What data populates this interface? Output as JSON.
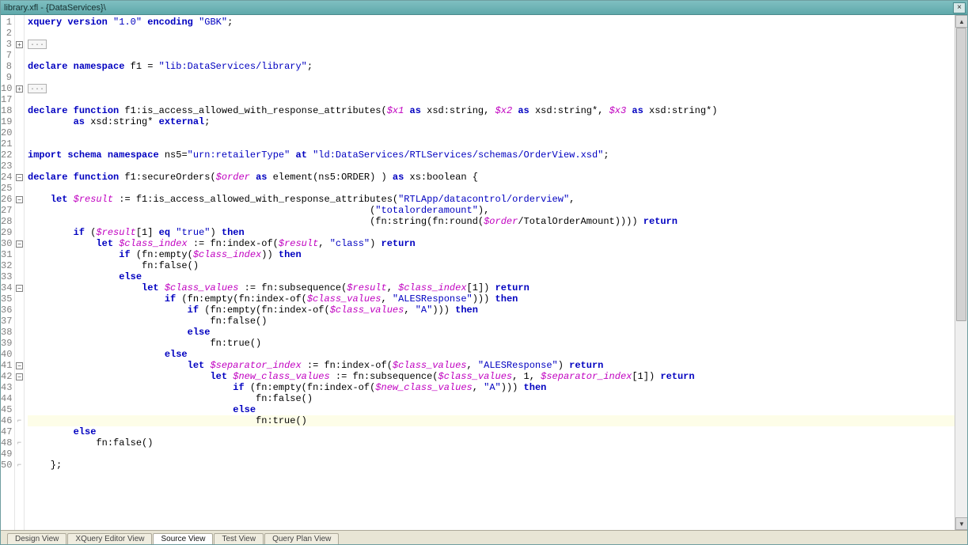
{
  "title": "library.xfl - {DataServices}\\",
  "close_label": "×",
  "fold_stub": "...",
  "scrollbar": {
    "up": "▲",
    "down": "▼"
  },
  "tabs": [
    {
      "label": "Design View"
    },
    {
      "label": "XQuery Editor View"
    },
    {
      "label": "Source View",
      "active": true
    },
    {
      "label": "Test View"
    },
    {
      "label": "Query Plan View"
    }
  ],
  "cursor_line_index": 36,
  "lines": [
    {
      "num": 1,
      "tokens": [
        [
          "kw",
          "xquery"
        ],
        [
          "norm",
          " "
        ],
        [
          "kw",
          "version"
        ],
        [
          "norm",
          " "
        ],
        [
          "str",
          "\"1.0\""
        ],
        [
          "norm",
          " "
        ],
        [
          "kw",
          "encoding"
        ],
        [
          "norm",
          " "
        ],
        [
          "str",
          "\"GBK\""
        ],
        [
          "norm",
          ";"
        ]
      ]
    },
    {
      "num": 2,
      "tokens": []
    },
    {
      "num": 3,
      "fold": "plus",
      "stub": true,
      "tokens": []
    },
    {
      "num": 7,
      "tokens": []
    },
    {
      "num": 8,
      "tokens": [
        [
          "kw",
          "declare"
        ],
        [
          "norm",
          " "
        ],
        [
          "kw",
          "namespace"
        ],
        [
          "norm",
          " f1 = "
        ],
        [
          "str",
          "\"lib:DataServices/library\""
        ],
        [
          "norm",
          ";"
        ]
      ]
    },
    {
      "num": 9,
      "tokens": []
    },
    {
      "num": 10,
      "fold": "plus",
      "stub": true,
      "tokens": []
    },
    {
      "num": 17,
      "tokens": []
    },
    {
      "num": 18,
      "tokens": [
        [
          "kw",
          "declare"
        ],
        [
          "norm",
          " "
        ],
        [
          "kw",
          "function"
        ],
        [
          "norm",
          " f1:is_access_allowed_with_response_attributes("
        ],
        [
          "var",
          "$x1"
        ],
        [
          "norm",
          " "
        ],
        [
          "kw",
          "as"
        ],
        [
          "norm",
          " xsd:string, "
        ],
        [
          "var",
          "$x2"
        ],
        [
          "norm",
          " "
        ],
        [
          "kw",
          "as"
        ],
        [
          "norm",
          " xsd:string*, "
        ],
        [
          "var",
          "$x3"
        ],
        [
          "norm",
          " "
        ],
        [
          "kw",
          "as"
        ],
        [
          "norm",
          " xsd:string*)"
        ]
      ]
    },
    {
      "num": 19,
      "tokens": [
        [
          "norm",
          "        "
        ],
        [
          "kw",
          "as"
        ],
        [
          "norm",
          " xsd:string* "
        ],
        [
          "kw",
          "external"
        ],
        [
          "norm",
          ";"
        ]
      ]
    },
    {
      "num": 20,
      "tokens": []
    },
    {
      "num": 21,
      "tokens": []
    },
    {
      "num": 22,
      "tokens": [
        [
          "kw",
          "import"
        ],
        [
          "norm",
          " "
        ],
        [
          "kw",
          "schema"
        ],
        [
          "norm",
          " "
        ],
        [
          "kw",
          "namespace"
        ],
        [
          "norm",
          " ns5="
        ],
        [
          "str",
          "\"urn:retailerType\""
        ],
        [
          "norm",
          " "
        ],
        [
          "kw",
          "at"
        ],
        [
          "norm",
          " "
        ],
        [
          "str",
          "\"ld:DataServices/RTLServices/schemas/OrderView.xsd\""
        ],
        [
          "norm",
          ";"
        ]
      ]
    },
    {
      "num": 23,
      "tokens": []
    },
    {
      "num": 24,
      "fold": "minus",
      "tokens": [
        [
          "kw",
          "declare"
        ],
        [
          "norm",
          " "
        ],
        [
          "kw",
          "function"
        ],
        [
          "norm",
          " f1:secureOrders("
        ],
        [
          "var",
          "$order"
        ],
        [
          "norm",
          " "
        ],
        [
          "kw",
          "as"
        ],
        [
          "norm",
          " element(ns5:ORDER) ) "
        ],
        [
          "kw",
          "as"
        ],
        [
          "norm",
          " xs:boolean {"
        ]
      ]
    },
    {
      "num": 25,
      "tokens": []
    },
    {
      "num": 26,
      "fold": "minus",
      "tokens": [
        [
          "norm",
          "    "
        ],
        [
          "kw",
          "let"
        ],
        [
          "norm",
          " "
        ],
        [
          "var",
          "$result"
        ],
        [
          "norm",
          " := f1:is_access_allowed_with_response_attributes("
        ],
        [
          "str",
          "\"RTLApp/datacontrol/orderview\""
        ],
        [
          "norm",
          ","
        ]
      ]
    },
    {
      "num": 27,
      "tokens": [
        [
          "norm",
          "                                                            ("
        ],
        [
          "str",
          "\"totalorderamount\""
        ],
        [
          "norm",
          "),"
        ]
      ]
    },
    {
      "num": 28,
      "tokens": [
        [
          "norm",
          "                                                            (fn:string(fn:round("
        ],
        [
          "var",
          "$order"
        ],
        [
          "norm",
          "/TotalOrderAmount)))) "
        ],
        [
          "kw",
          "return"
        ]
      ]
    },
    {
      "num": 29,
      "tokens": [
        [
          "norm",
          "        "
        ],
        [
          "kw",
          "if"
        ],
        [
          "norm",
          " ("
        ],
        [
          "var",
          "$result"
        ],
        [
          "norm",
          "[1] "
        ],
        [
          "kw",
          "eq"
        ],
        [
          "norm",
          " "
        ],
        [
          "str",
          "\"true\""
        ],
        [
          "norm",
          ") "
        ],
        [
          "kw",
          "then"
        ]
      ]
    },
    {
      "num": 30,
      "fold": "minus",
      "tokens": [
        [
          "norm",
          "            "
        ],
        [
          "kw",
          "let"
        ],
        [
          "norm",
          " "
        ],
        [
          "var",
          "$class_index"
        ],
        [
          "norm",
          " := fn:index-of("
        ],
        [
          "var",
          "$result"
        ],
        [
          "norm",
          ", "
        ],
        [
          "str",
          "\"class\""
        ],
        [
          "norm",
          ") "
        ],
        [
          "kw",
          "return"
        ]
      ]
    },
    {
      "num": 31,
      "tokens": [
        [
          "norm",
          "                "
        ],
        [
          "kw",
          "if"
        ],
        [
          "norm",
          " (fn:empty("
        ],
        [
          "var",
          "$class_index"
        ],
        [
          "norm",
          ")) "
        ],
        [
          "kw",
          "then"
        ]
      ]
    },
    {
      "num": 32,
      "tokens": [
        [
          "norm",
          "                    fn:false()"
        ]
      ]
    },
    {
      "num": 33,
      "tokens": [
        [
          "norm",
          "                "
        ],
        [
          "kw",
          "else"
        ]
      ]
    },
    {
      "num": 34,
      "fold": "minus",
      "tokens": [
        [
          "norm",
          "                    "
        ],
        [
          "kw",
          "let"
        ],
        [
          "norm",
          " "
        ],
        [
          "var",
          "$class_values"
        ],
        [
          "norm",
          " := fn:subsequence("
        ],
        [
          "var",
          "$result"
        ],
        [
          "norm",
          ", "
        ],
        [
          "var",
          "$class_index"
        ],
        [
          "norm",
          "[1]) "
        ],
        [
          "kw",
          "return"
        ]
      ]
    },
    {
      "num": 35,
      "tokens": [
        [
          "norm",
          "                        "
        ],
        [
          "kw",
          "if"
        ],
        [
          "norm",
          " (fn:empty(fn:index-of("
        ],
        [
          "var",
          "$class_values"
        ],
        [
          "norm",
          ", "
        ],
        [
          "str",
          "\"ALESResponse\""
        ],
        [
          "norm",
          "))) "
        ],
        [
          "kw",
          "then"
        ]
      ]
    },
    {
      "num": 36,
      "tokens": [
        [
          "norm",
          "                            "
        ],
        [
          "kw",
          "if"
        ],
        [
          "norm",
          " (fn:empty(fn:index-of("
        ],
        [
          "var",
          "$class_values"
        ],
        [
          "norm",
          ", "
        ],
        [
          "str",
          "\"A\""
        ],
        [
          "norm",
          "))) "
        ],
        [
          "kw",
          "then"
        ]
      ]
    },
    {
      "num": 37,
      "tokens": [
        [
          "norm",
          "                                fn:false()"
        ]
      ]
    },
    {
      "num": 38,
      "tokens": [
        [
          "norm",
          "                            "
        ],
        [
          "kw",
          "else"
        ]
      ]
    },
    {
      "num": 39,
      "tokens": [
        [
          "norm",
          "                                fn:true()"
        ]
      ]
    },
    {
      "num": 40,
      "tokens": [
        [
          "norm",
          "                        "
        ],
        [
          "kw",
          "else"
        ]
      ]
    },
    {
      "num": 41,
      "fold": "minus",
      "tokens": [
        [
          "norm",
          "                            "
        ],
        [
          "kw",
          "let"
        ],
        [
          "norm",
          " "
        ],
        [
          "var",
          "$separator_index"
        ],
        [
          "norm",
          " := fn:index-of("
        ],
        [
          "var",
          "$class_values"
        ],
        [
          "norm",
          ", "
        ],
        [
          "str",
          "\"ALESResponse\""
        ],
        [
          "norm",
          ") "
        ],
        [
          "kw",
          "return"
        ]
      ]
    },
    {
      "num": 42,
      "fold": "minus",
      "tokens": [
        [
          "norm",
          "                                "
        ],
        [
          "kw",
          "let"
        ],
        [
          "norm",
          " "
        ],
        [
          "var",
          "$new_class_values"
        ],
        [
          "norm",
          " := fn:subsequence("
        ],
        [
          "var",
          "$class_values"
        ],
        [
          "norm",
          ", 1, "
        ],
        [
          "var",
          "$separator_index"
        ],
        [
          "norm",
          "[1]) "
        ],
        [
          "kw",
          "return"
        ]
      ]
    },
    {
      "num": 43,
      "tokens": [
        [
          "norm",
          "                                    "
        ],
        [
          "kw",
          "if"
        ],
        [
          "norm",
          " (fn:empty(fn:index-of("
        ],
        [
          "var",
          "$new_class_values"
        ],
        [
          "norm",
          ", "
        ],
        [
          "str",
          "\"A\""
        ],
        [
          "norm",
          "))) "
        ],
        [
          "kw",
          "then"
        ]
      ]
    },
    {
      "num": 44,
      "tokens": [
        [
          "norm",
          "                                        fn:false()"
        ]
      ]
    },
    {
      "num": 45,
      "tokens": [
        [
          "norm",
          "                                    "
        ],
        [
          "kw",
          "else"
        ]
      ]
    },
    {
      "num": 46,
      "fold": "close",
      "tokens": [
        [
          "norm",
          "                                        fn:true()"
        ]
      ]
    },
    {
      "num": 47,
      "tokens": [
        [
          "norm",
          "        "
        ],
        [
          "kw",
          "else"
        ]
      ]
    },
    {
      "num": 48,
      "fold": "close",
      "tokens": [
        [
          "norm",
          "            fn:false()"
        ]
      ]
    },
    {
      "num": 49,
      "tokens": []
    },
    {
      "num": 50,
      "fold": "close",
      "tokens": [
        [
          "norm",
          "    };"
        ]
      ]
    }
  ]
}
